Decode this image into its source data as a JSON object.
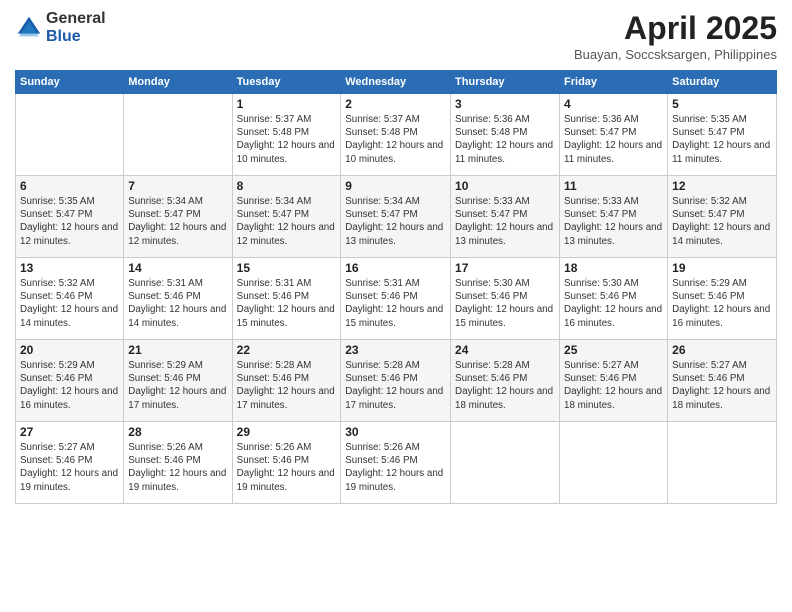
{
  "logo": {
    "general": "General",
    "blue": "Blue"
  },
  "header": {
    "title": "April 2025",
    "location": "Buayan, Soccsksargen, Philippines"
  },
  "weekdays": [
    "Sunday",
    "Monday",
    "Tuesday",
    "Wednesday",
    "Thursday",
    "Friday",
    "Saturday"
  ],
  "weeks": [
    [
      {
        "day": "",
        "info": ""
      },
      {
        "day": "",
        "info": ""
      },
      {
        "day": "1",
        "info": "Sunrise: 5:37 AM\nSunset: 5:48 PM\nDaylight: 12 hours and 10 minutes."
      },
      {
        "day": "2",
        "info": "Sunrise: 5:37 AM\nSunset: 5:48 PM\nDaylight: 12 hours and 10 minutes."
      },
      {
        "day": "3",
        "info": "Sunrise: 5:36 AM\nSunset: 5:48 PM\nDaylight: 12 hours and 11 minutes."
      },
      {
        "day": "4",
        "info": "Sunrise: 5:36 AM\nSunset: 5:47 PM\nDaylight: 12 hours and 11 minutes."
      },
      {
        "day": "5",
        "info": "Sunrise: 5:35 AM\nSunset: 5:47 PM\nDaylight: 12 hours and 11 minutes."
      }
    ],
    [
      {
        "day": "6",
        "info": "Sunrise: 5:35 AM\nSunset: 5:47 PM\nDaylight: 12 hours and 12 minutes."
      },
      {
        "day": "7",
        "info": "Sunrise: 5:34 AM\nSunset: 5:47 PM\nDaylight: 12 hours and 12 minutes."
      },
      {
        "day": "8",
        "info": "Sunrise: 5:34 AM\nSunset: 5:47 PM\nDaylight: 12 hours and 12 minutes."
      },
      {
        "day": "9",
        "info": "Sunrise: 5:34 AM\nSunset: 5:47 PM\nDaylight: 12 hours and 13 minutes."
      },
      {
        "day": "10",
        "info": "Sunrise: 5:33 AM\nSunset: 5:47 PM\nDaylight: 12 hours and 13 minutes."
      },
      {
        "day": "11",
        "info": "Sunrise: 5:33 AM\nSunset: 5:47 PM\nDaylight: 12 hours and 13 minutes."
      },
      {
        "day": "12",
        "info": "Sunrise: 5:32 AM\nSunset: 5:47 PM\nDaylight: 12 hours and 14 minutes."
      }
    ],
    [
      {
        "day": "13",
        "info": "Sunrise: 5:32 AM\nSunset: 5:46 PM\nDaylight: 12 hours and 14 minutes."
      },
      {
        "day": "14",
        "info": "Sunrise: 5:31 AM\nSunset: 5:46 PM\nDaylight: 12 hours and 14 minutes."
      },
      {
        "day": "15",
        "info": "Sunrise: 5:31 AM\nSunset: 5:46 PM\nDaylight: 12 hours and 15 minutes."
      },
      {
        "day": "16",
        "info": "Sunrise: 5:31 AM\nSunset: 5:46 PM\nDaylight: 12 hours and 15 minutes."
      },
      {
        "day": "17",
        "info": "Sunrise: 5:30 AM\nSunset: 5:46 PM\nDaylight: 12 hours and 15 minutes."
      },
      {
        "day": "18",
        "info": "Sunrise: 5:30 AM\nSunset: 5:46 PM\nDaylight: 12 hours and 16 minutes."
      },
      {
        "day": "19",
        "info": "Sunrise: 5:29 AM\nSunset: 5:46 PM\nDaylight: 12 hours and 16 minutes."
      }
    ],
    [
      {
        "day": "20",
        "info": "Sunrise: 5:29 AM\nSunset: 5:46 PM\nDaylight: 12 hours and 16 minutes."
      },
      {
        "day": "21",
        "info": "Sunrise: 5:29 AM\nSunset: 5:46 PM\nDaylight: 12 hours and 17 minutes."
      },
      {
        "day": "22",
        "info": "Sunrise: 5:28 AM\nSunset: 5:46 PM\nDaylight: 12 hours and 17 minutes."
      },
      {
        "day": "23",
        "info": "Sunrise: 5:28 AM\nSunset: 5:46 PM\nDaylight: 12 hours and 17 minutes."
      },
      {
        "day": "24",
        "info": "Sunrise: 5:28 AM\nSunset: 5:46 PM\nDaylight: 12 hours and 18 minutes."
      },
      {
        "day": "25",
        "info": "Sunrise: 5:27 AM\nSunset: 5:46 PM\nDaylight: 12 hours and 18 minutes."
      },
      {
        "day": "26",
        "info": "Sunrise: 5:27 AM\nSunset: 5:46 PM\nDaylight: 12 hours and 18 minutes."
      }
    ],
    [
      {
        "day": "27",
        "info": "Sunrise: 5:27 AM\nSunset: 5:46 PM\nDaylight: 12 hours and 19 minutes."
      },
      {
        "day": "28",
        "info": "Sunrise: 5:26 AM\nSunset: 5:46 PM\nDaylight: 12 hours and 19 minutes."
      },
      {
        "day": "29",
        "info": "Sunrise: 5:26 AM\nSunset: 5:46 PM\nDaylight: 12 hours and 19 minutes."
      },
      {
        "day": "30",
        "info": "Sunrise: 5:26 AM\nSunset: 5:46 PM\nDaylight: 12 hours and 19 minutes."
      },
      {
        "day": "",
        "info": ""
      },
      {
        "day": "",
        "info": ""
      },
      {
        "day": "",
        "info": ""
      }
    ]
  ]
}
